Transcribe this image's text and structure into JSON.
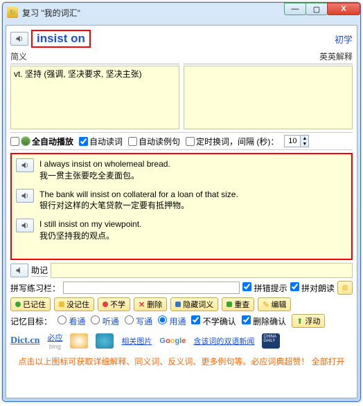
{
  "titlebar": {
    "text": "复习  \"我的词汇\""
  },
  "win_btns": {
    "min": "—",
    "max": "▢",
    "close": "X"
  },
  "header": {
    "word": "insist on",
    "level_link": "初学"
  },
  "defs": {
    "left_label": "简义",
    "right_label": "英英解释",
    "left_text": "vt. 坚持 (强调, 坚决要求, 坚决主张)",
    "right_text": ""
  },
  "opts": {
    "auto_play": "全自动播放",
    "auto_word": "自动读词",
    "auto_example": "自动读例句",
    "auto_switch": "定时换词，间隔 (秒)：",
    "interval": "10"
  },
  "examples": [
    {
      "en": "I always insist on wholemeal bread.",
      "zh": "我一贯主张要吃全麦面包。"
    },
    {
      "en": "The bank will insist on collateral for a loan of that size.",
      "zh": "银行对这样的大笔贷款一定要有抵押物。"
    },
    {
      "en": "I still insist on my viewpoint.",
      "zh": "我仍坚持我的观点。"
    }
  ],
  "notes": {
    "label": "助记",
    "value": ""
  },
  "pinxie": {
    "label": "拼写练习栏：",
    "value": "",
    "hint": "拼错提示",
    "read": "拼对朗读"
  },
  "action_btns": {
    "known": "已记住",
    "unknown": "没记住",
    "nolearn": "不学",
    "delete": "删除",
    "hideword": "隐藏词义",
    "retry": "重查",
    "edit": "编辑"
  },
  "goal": {
    "label": "记忆目标：",
    "opts": [
      "看通",
      "听通",
      "写通",
      "用通"
    ],
    "confirm1": "不学确认",
    "confirm2": "删除确认",
    "float_btn": "浮动"
  },
  "brands": {
    "dict": "Dict.cn",
    "biying": "必应",
    "sougou": "",
    "qihu": "",
    "xgpic": "相关图片",
    "google": "Google",
    "shuangyu": "含该词的双语新闻",
    "chinadaily": "CHINA DAILY"
  },
  "footer_tip": "点击以上图标可获取详细解释、同义词、反义词、更多例句等。必应词典超赞！  全部打开"
}
